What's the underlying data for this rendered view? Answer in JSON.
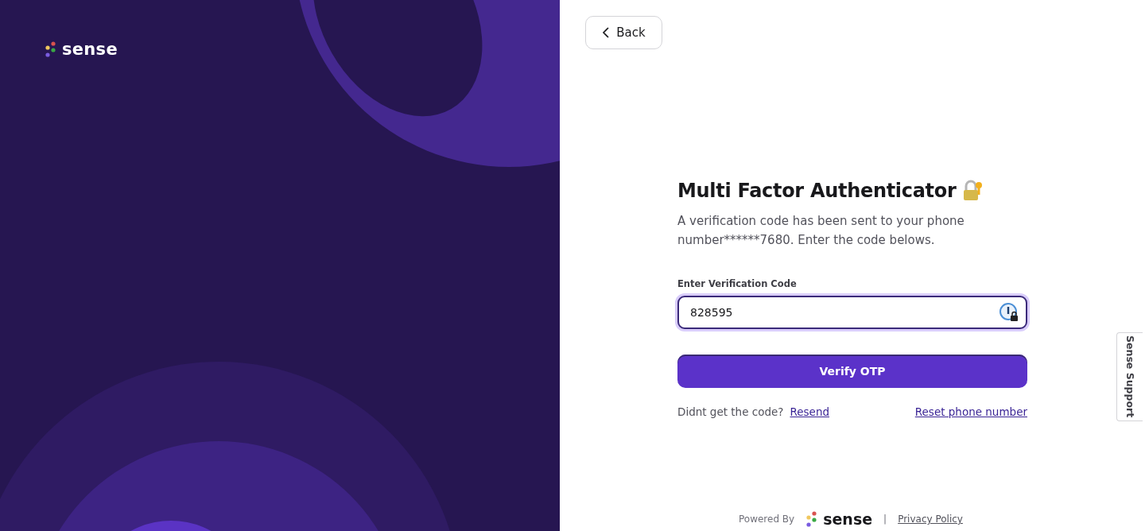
{
  "brand": {
    "name": "sense"
  },
  "back_button": {
    "label": "Back"
  },
  "form": {
    "title": "Multi Factor Authenticator",
    "description": "A verification code has been sent to your phone number******7680. Enter the code belows.",
    "field": {
      "label": "Enter Verification Code",
      "value": "828595",
      "focused": true
    },
    "submit": {
      "label": "Verify OTP"
    },
    "resend_prompt": "Didnt get the code?",
    "resend_link": "Resend",
    "reset_link": "Reset phone number"
  },
  "support_tab": {
    "label": "Sense Support"
  },
  "footer": {
    "powered_by": "Powered By",
    "brand": "sense",
    "separator": "|",
    "privacy_link": "Privacy Policy"
  }
}
